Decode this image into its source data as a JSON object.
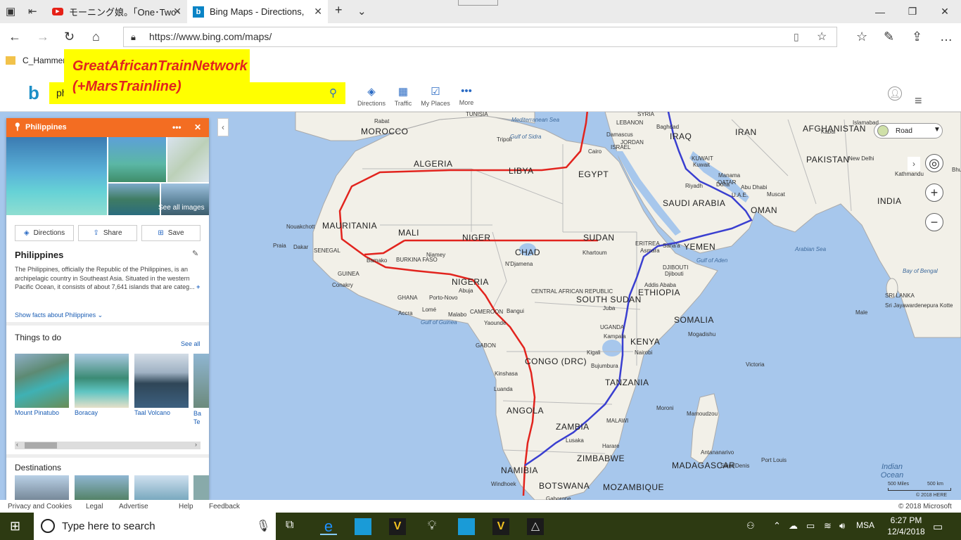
{
  "browser": {
    "tabs": [
      {
        "label": "モーニング娘。「One･Two･"
      },
      {
        "label": "Bing Maps - Directions,"
      }
    ],
    "url": "https://www.bing.com/maps/",
    "favorites": [
      {
        "label": "C_Hammer"
      }
    ]
  },
  "banner": {
    "line1": "GreatAfricanTrainNetwork",
    "line2": "(+MarsTrainline)",
    "color": "#e2241e",
    "background": "#ffff00"
  },
  "bing": {
    "search_value": "philippines",
    "buttons": [
      {
        "label": "Directions"
      },
      {
        "label": "Traffic"
      },
      {
        "label": "My Places"
      },
      {
        "label": "More"
      }
    ]
  },
  "panel": {
    "header": "Philippines",
    "see_all_images": "See all images",
    "actions": [
      {
        "label": "Directions"
      },
      {
        "label": "Share"
      },
      {
        "label": "Save"
      }
    ],
    "title": "Philippines",
    "description": "The Philippines, officially the Republic of the Philippines, is an archipelagic country in Southeast Asia. Situated in the western Pacific Ocean, it consists of about 7,641 islands that are categ...",
    "more_glyph": "+",
    "show_facts": "Show facts about Philippines",
    "things_to_do": "Things to do",
    "see_all": "See all",
    "places": [
      {
        "label": "Mount Pinatubo"
      },
      {
        "label": "Boracay"
      },
      {
        "label": "Taal Volcano"
      },
      {
        "label": "Ba\nTe"
      }
    ],
    "destinations": "Destinations"
  },
  "map": {
    "style_dropdown": "Road",
    "labels": {
      "countries": [
        "ALGERIA",
        "LIBYA",
        "EGYPT",
        "MAURITANIA",
        "MALI",
        "NIGER",
        "SUDAN",
        "CHAD",
        "NIGERIA",
        "ETHIOPIA",
        "SOMALIA",
        "CONGO (DRC)",
        "ANGOLA",
        "ZAMBIA",
        "TANZANIA",
        "NAMIBIA",
        "BOTSWANA",
        "MOZAMBIQUE",
        "SAUDI ARABIA",
        "YEMEN",
        "OMAN",
        "IRAQ",
        "IRAN",
        "SYRIA",
        "AFGHANISTAN",
        "PAKISTAN",
        "INDIA",
        "MOROCCO",
        "TUNISIA",
        "KENYA",
        "UGANDA",
        "MADAGASCAR",
        "ZIMBABWE",
        "MALAWI",
        "SOUTH SUDAN",
        "CENTRAL AFRICAN REPUBLIC",
        "CAMEROON",
        "SENEGAL",
        "GUINEA",
        "BURKINA FASO",
        "GHANA",
        "GABON",
        "ERITREA",
        "DJIBOUTI",
        "SRI LANKA",
        "JORDAN",
        "KUWAIT",
        "ISRAEL",
        "LEBANON",
        "U.A.E.",
        "QATAR"
      ],
      "cities": [
        "Rabat",
        "Tripoli",
        "Cairo",
        "Damascus",
        "Baghdad",
        "Riyadh",
        "Manama",
        "Abu Dhabi",
        "Muscat",
        "Sana'a",
        "Khartoum",
        "Addis Ababa",
        "Mogadishu",
        "Nairobi",
        "Kampala",
        "Kigali",
        "Bujumbura",
        "Kinshasa",
        "Luanda",
        "Lusaka",
        "Harare",
        "Windhoek",
        "Gaborone",
        "Antananarivo",
        "Saint-Denis",
        "Port Louis",
        "Victoria",
        "Moroni",
        "Mamoudzou",
        "N'Djamena",
        "Niamey",
        "Bamako",
        "Abuja",
        "Yaounde",
        "Malabo",
        "Lomé",
        "Accra",
        "Porto-Novo",
        "Dakar",
        "Nouakchott",
        "Praia",
        "Conakry",
        "Bangui",
        "Juba",
        "Kabul",
        "Islamabad",
        "New Delhi",
        "Kathmandu",
        "Male",
        "Sri Jayawardenepura Kotte",
        "Doha",
        "Djibouti",
        "Asmara",
        "Kuwait"
      ],
      "seas": [
        "Mediterranean Sea",
        "Gulf of Sidra",
        "Arabian Sea",
        "Bay of Bengal",
        "Gulf of Aden",
        "Gulf of Guinea"
      ],
      "ocean": "Indian Ocean"
    },
    "scale": [
      "500 Miles",
      "500 km"
    ],
    "copyright_here": "© 2018 HERE",
    "routes": [
      {
        "name": "GreatAfricanTrainNetwork",
        "color": "#e2241e"
      },
      {
        "name": "MarsTrainline",
        "color": "#3a3fd0"
      }
    ]
  },
  "footer": {
    "links": [
      "Privacy and Cookies",
      "Legal",
      "Advertise",
      "Help",
      "Feedback"
    ],
    "copyright": "© 2018 Microsoft"
  },
  "taskbar": {
    "search_placeholder": "Type here to search",
    "lang": "MSA",
    "time": "6:27 PM",
    "date": "12/4/2018"
  }
}
